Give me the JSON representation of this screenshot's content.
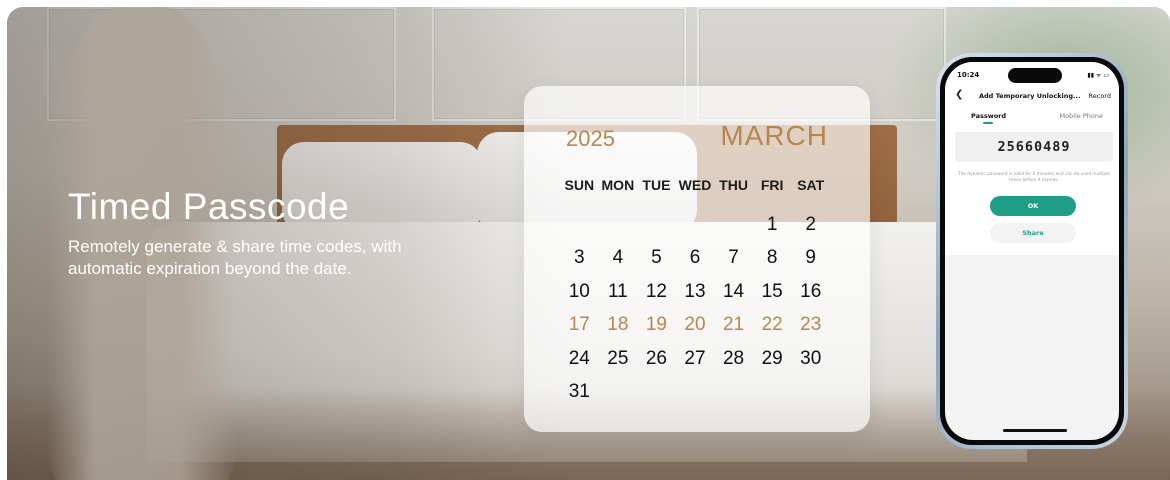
{
  "hero": {
    "title": "Timed Passcode",
    "description": "Remotely generate & share time codes, with automatic expiration beyond the date."
  },
  "calendar": {
    "year": "2025",
    "month": "MARCH",
    "weekdays": [
      "SUN",
      "MON",
      "TUE",
      "WED",
      "THU",
      "FRI",
      "SAT"
    ],
    "first_weekday_index": 5,
    "days": [
      "1",
      "2",
      "3",
      "4",
      "5",
      "6",
      "7",
      "8",
      "9",
      "10",
      "11",
      "12",
      "13",
      "14",
      "15",
      "16",
      "17",
      "18",
      "19",
      "20",
      "21",
      "22",
      "23",
      "24",
      "25",
      "26",
      "27",
      "28",
      "29",
      "30",
      "31"
    ],
    "highlighted_days": [
      "17",
      "18",
      "19",
      "20",
      "21",
      "22",
      "23"
    ],
    "highlight_color": "#b6874c"
  },
  "phone": {
    "status_time": "10:24",
    "status_icons": "▮▮ ᯤ ▭",
    "back_icon": "chevron-left-icon",
    "nav_title": "Add Temporary Unlocking...",
    "nav_record": "Record",
    "tabs": [
      "Password",
      "Mobile Phone"
    ],
    "active_tab": "Password",
    "password": "25660489",
    "note": "The dynamic password is valid for 5 minutes and can be used multiple times before it expires.",
    "ok_label": "OK",
    "share_label": "Share",
    "accent_color": "#1e9e86"
  }
}
